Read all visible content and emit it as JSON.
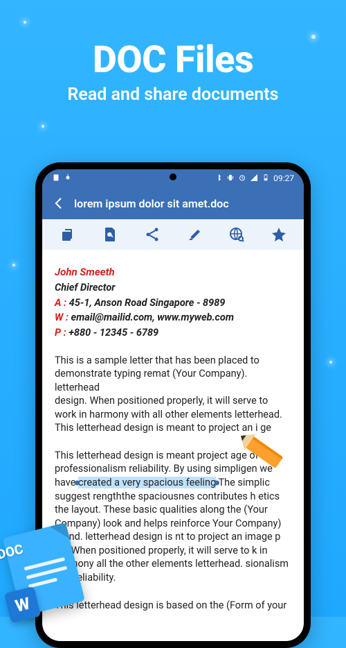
{
  "promo": {
    "title": "DOC Files",
    "subtitle": "Read and share documents"
  },
  "statusbar": {
    "time": "09:27",
    "icons": {
      "left1": "notif-icon",
      "left2": "android-icon",
      "bt": "bluetooth-icon",
      "vib": "vibrate-icon",
      "alarm": "alarm-icon",
      "signal": "signal-icon",
      "battery": "battery-icon"
    }
  },
  "appbar": {
    "title": "lorem ipsum dolor sit amet.doc"
  },
  "toolbar": {
    "copy": "copy",
    "search": "search",
    "share": "share",
    "highlight": "highlight",
    "web": "web-search",
    "star": "star"
  },
  "document": {
    "name": "John Smeeth",
    "role": "Chief Director",
    "addressKey": "A :",
    "address": "45-1, Anson Road Singapore - 8989",
    "webKey": "W :",
    "web": "email@mailid.com, www.myweb.com",
    "phoneKey": "P :",
    "phone": "+880 - 12345 - 6789",
    "para1": "This is a sample letter that has been placed to demonstrate typing remat (Your Company). letterhead",
    "para1b": "design. When positioned properly, it will serve to work in harmony with all other elements letterhead. This letterhead design is meant to project an i",
    "para1tail": "ge",
    "para2a": "This letterhead design is meant project a",
    "para2a_tail": "ge of professionalism reliability. By using simpl",
    "para2a_tail2": "igen we have ",
    "highlight": "created a very spacious feeling",
    "para2b": " The simplic suggest  rengththe spaciousnes contributes h etics the layout. These basic qualities along the (Your Company) look and helps reinforce Your Company) brand. letterhead design is nt to project an image p",
    "para2c": "gn. When positioned properly, it will serve to k in harmony all the other elements letterhead. sionalism and reliability.",
    "para3": "This letterhead design is based on the (Form of your"
  },
  "docbadge": {
    "label": "DOC",
    "w": "W"
  }
}
